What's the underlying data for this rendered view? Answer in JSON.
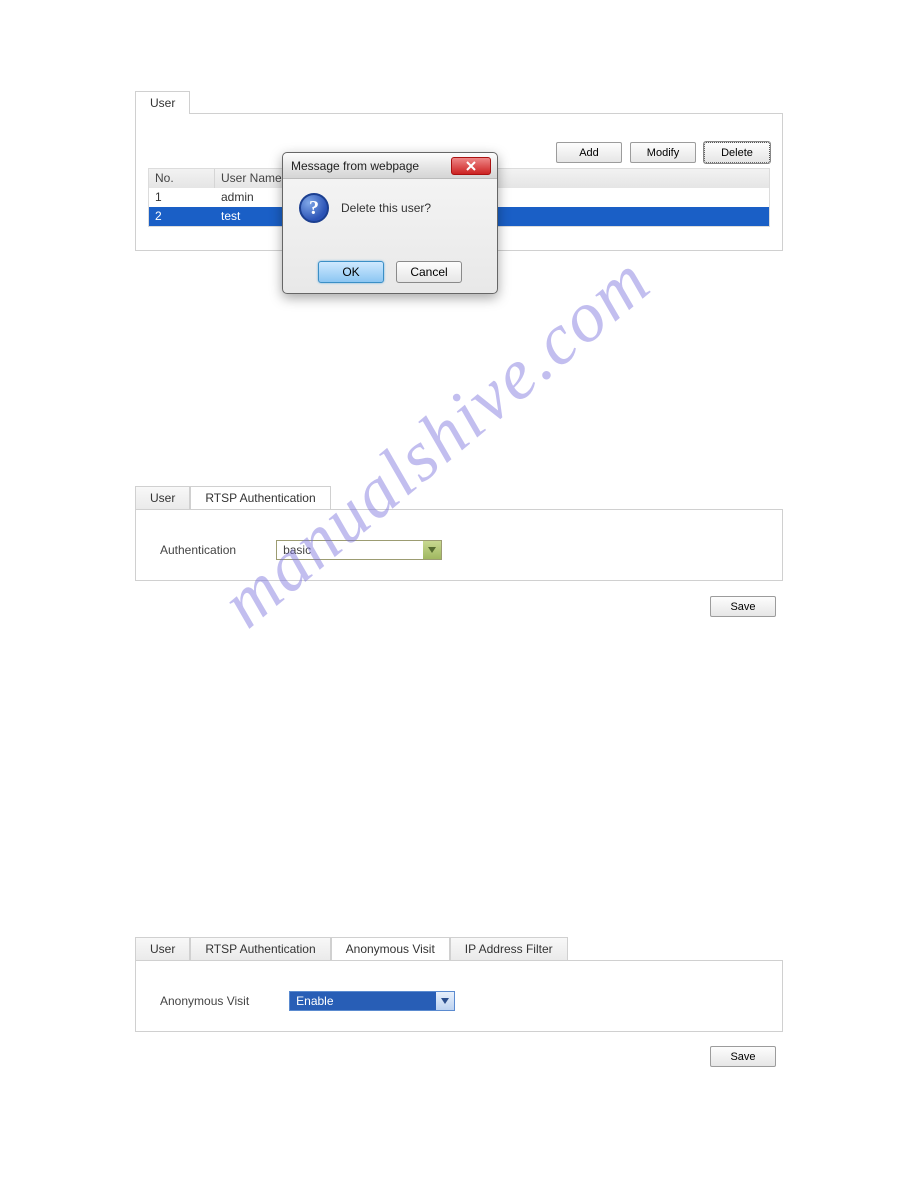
{
  "watermark": "manualshive.com",
  "section1": {
    "tabs": [
      {
        "label": "User",
        "active": true
      }
    ],
    "buttons": {
      "add": "Add",
      "modify": "Modify",
      "delete": "Delete"
    },
    "table": {
      "headers": {
        "no": "No.",
        "username": "User Name"
      },
      "rows": [
        {
          "no": "1",
          "username": "admin",
          "selected": false
        },
        {
          "no": "2",
          "username": "test",
          "selected": true
        }
      ]
    }
  },
  "dialog": {
    "title": "Message from webpage",
    "text": "Delete this user?",
    "ok": "OK",
    "cancel": "Cancel"
  },
  "section2": {
    "tabs": [
      {
        "label": "User",
        "active": false
      },
      {
        "label": "RTSP Authentication",
        "active": true
      }
    ],
    "field_label": "Authentication",
    "field_value": "basic",
    "save": "Save"
  },
  "section3": {
    "tabs": [
      {
        "label": "User",
        "active": false
      },
      {
        "label": "RTSP Authentication",
        "active": false
      },
      {
        "label": "Anonymous Visit",
        "active": true
      },
      {
        "label": "IP Address Filter",
        "active": false
      }
    ],
    "field_label": "Anonymous Visit",
    "field_value": "Enable",
    "save": "Save"
  }
}
